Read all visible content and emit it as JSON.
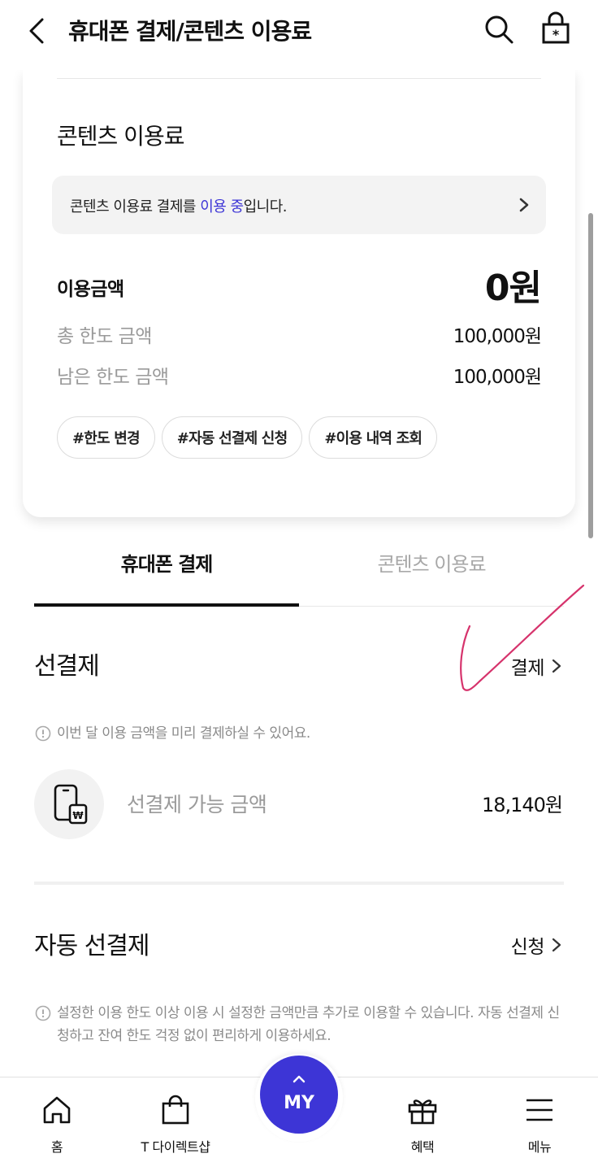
{
  "header": {
    "title": "휴대폰 결제/콘텐츠 이용료",
    "icons": [
      "back-arrow-icon",
      "search-icon",
      "lock-icon"
    ]
  },
  "content_fee_card": {
    "title": "콘텐츠 이용료",
    "notice_prefix": "콘텐츠 이용료 결제를 ",
    "notice_highlight": "이용 중",
    "notice_suffix": "입니다.",
    "usage_label": "이용금액",
    "usage_value": "0원",
    "total_limit_label": "총 한도 금액",
    "total_limit_value": "100,000원",
    "remaining_limit_label": "남은 한도 금액",
    "remaining_limit_value": "100,000원",
    "chips": [
      "#한도 변경",
      "#자동 선결제 신청",
      "#이용 내역 조회"
    ]
  },
  "tabs": {
    "phone_payment": "휴대폰 결제",
    "content_fee": "콘텐츠 이용료",
    "active": "휴대폰 결제"
  },
  "prepayment": {
    "title": "선결제",
    "link_label": "결제",
    "info": "이번 달 이용 금액을 미리 결제하실 수 있어요.",
    "available_label": "선결제 가능 금액",
    "available_value": "18,140원"
  },
  "auto_prepayment": {
    "title": "자동 선결제",
    "link_label": "신청",
    "info": "설정한 이용 한도 이상 이용 시 설정한 금액만큼 추가로 이용할 수 있습니다. 자동 선결제 신청하고 잔여 한도 걱정 없이 편리하게 이용하세요."
  },
  "bottom_nav": {
    "home": "홈",
    "shop": "T 다이렉트샵",
    "my": "MY",
    "benefits": "혜택",
    "menu": "메뉴"
  },
  "colors": {
    "accent": "#3d35d6",
    "annotation": "#d6336c"
  }
}
